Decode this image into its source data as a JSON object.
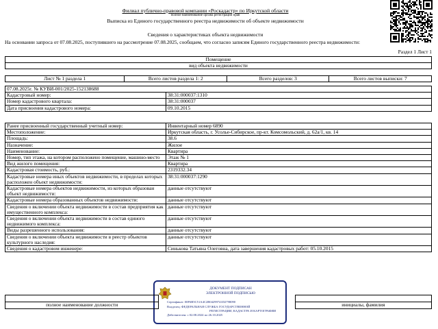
{
  "header": {
    "org": "Филиал публично-правовой компании «Роскадастр» по Иркутской области",
    "org_caption": "полное наименование органа регистрации прав",
    "title": "Выписка из Единого государственного реестра недвижимости об объекте недвижимости",
    "section": "Сведения о характеристиках объекта недвижимости",
    "request": "На   основании запроса от 07.08.2025, поступившего на рассмотрение 07.08.2025, сообщаем, что согласно записям Единого государственного реестра недвижимости:"
  },
  "razdel": "Раздел 1 Лист 1",
  "object": {
    "type": "Помещение",
    "type_caption": "вид объекта недвижимости"
  },
  "sheets": {
    "sheet": "Лист № 1 раздела 1",
    "total_sheets": "Всего листов раздела 1: 2",
    "total_sections": "Всего разделов: 3",
    "total_extract": "Всего листов выписки: 7"
  },
  "doc_number": "07.08.2025г. № КУВИ-001/2025-152138688",
  "main1": [
    {
      "label": "Кадастровый номер:",
      "value": "38:31:000037:1310"
    },
    {
      "label": "Номер кадастрового квартала:",
      "value": "38:31:000037"
    },
    {
      "label": "Дата присвоения кадастрового номера:",
      "value": "09.10.2015"
    }
  ],
  "main2": [
    {
      "label": "Ранее присвоенный государственный учетный номер:",
      "value": "Инвентарный номер 6890"
    },
    {
      "label": "Местоположение:",
      "value": "Иркутская область, г. Усолье-Сибирское, пр-кт. Комсомольский, д. 62а/1, кв. 14"
    },
    {
      "label": "Площадь:",
      "value": "38.6"
    },
    {
      "label": "Назначение:",
      "value": "Жилое"
    },
    {
      "label": "Наименование:",
      "value": "Квартира"
    },
    {
      "label": "Номер, тип этажа, на котором расположено помещение, машино-место",
      "value": "Этаж № 1"
    },
    {
      "label": "Вид жилого помещения:",
      "value": "Квартира"
    },
    {
      "label": "Кадастровая стоимость, руб.:",
      "value": "2319332.34"
    },
    {
      "label": "Кадастровые номера иных объектов недвижимости, в пределах которых расположен объект недвижимости:",
      "value": "38:31:000037:1290"
    },
    {
      "label": "Кадастровые номера объектов недвижимости, из которых образован объект недвижимости:",
      "value": "данные отсутствуют"
    },
    {
      "label": "Кадастровые номера образованных объектов недвижимости:",
      "value": "данные отсутствуют"
    },
    {
      "label": "Сведения о включении объекта недвижимости в состав предприятия как имущественного комплекса:",
      "value": "данные отсутствуют"
    },
    {
      "label": "Сведения о включении объекта недвижимости в состав единого недвижимого комплекса:",
      "value": "данные отсутствуют"
    },
    {
      "label": "Виды разрешенного использования:",
      "value": "данные отсутствуют"
    },
    {
      "label": "Сведения о включении объекта недвижимости в реестр объектов культурного наследия:",
      "value": "данные отсутствуют"
    },
    {
      "label": "Сведения о кадастровом инженере:",
      "value": "Синькова Татьяна Олеговна, дата завершения кадастровых работ: 05.10.2015"
    }
  ],
  "sign": {
    "position_caption": "полное наименование должности",
    "name_caption": "инициалы, фамилия"
  },
  "stamp": {
    "title": "ДОКУМЕНТ ПОДПИСАН",
    "subtitle": "ЭЛЕКТРОННОЙ ПОДПИСЬЮ",
    "cert": "Сертификат: 00F6B5C51A4C2B04299741D2798090",
    "owner": "Владелец: ФЕДЕРАЛЬНАЯ СЛУЖБА ГОСУДАРСТВЕННОЙ",
    "owner2": "РЕГИСТРАЦИИ, КАДАСТРА И КАРТОГРАФИИ",
    "valid": "Действителен: с 02.08.2024 по 26.10.2025"
  }
}
